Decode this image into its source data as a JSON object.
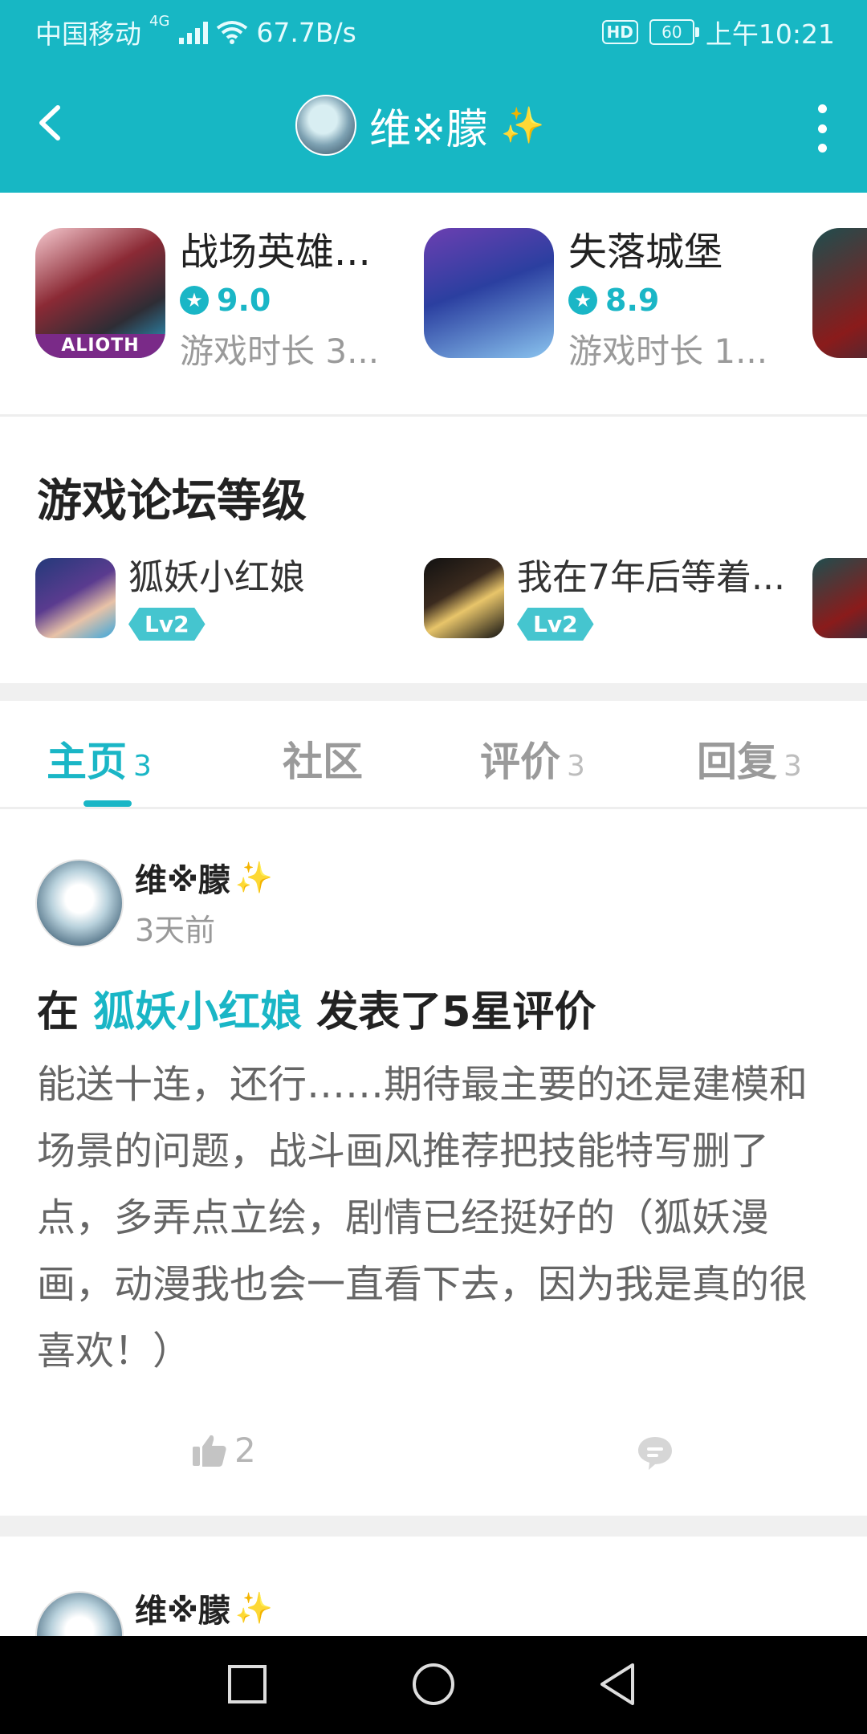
{
  "status_bar": {
    "carrier": "中国移动",
    "network": "4G",
    "speed": "67.7B/s",
    "hd": "HD",
    "battery": "60",
    "time": "上午10:21"
  },
  "app_bar": {
    "title": "维※朦",
    "title_emoji": "✨"
  },
  "games": [
    {
      "name": "战场英雄...",
      "rating": "9.0",
      "playtime": "游戏时长 3...",
      "badge": "ALIOTH"
    },
    {
      "name": "失落城堡",
      "rating": "8.9",
      "playtime": "游戏时长 1..."
    }
  ],
  "forum": {
    "title": "游戏论坛等级",
    "items": [
      {
        "name": "狐妖小红娘",
        "level": "Lv2"
      },
      {
        "name": "我在7年后等着...",
        "level": "Lv2"
      }
    ]
  },
  "tabs": [
    {
      "label": "主页",
      "count": "3"
    },
    {
      "label": "社区",
      "count": ""
    },
    {
      "label": "评价",
      "count": "3"
    },
    {
      "label": "回复",
      "count": "3"
    }
  ],
  "post": {
    "username": "维※朦",
    "emoji": "✨",
    "time": "3天前",
    "headline_prefix": "在",
    "headline_game": "狐妖小红娘",
    "headline_suffix": "发表了5星评价",
    "body": "能送十连，还行……期待最主要的还是建模和场景的问题，战斗画风推荐把技能特写删了点，多弄点立绘，剧情已经挺好的（狐妖漫画，动漫我也会一直看下去，因为我是真的很喜欢！）",
    "likes": "2"
  },
  "post2": {
    "username": "维※朦",
    "emoji": "✨"
  },
  "colors": {
    "accent": "#17b7c4",
    "text_primary": "#222222",
    "text_secondary": "#999999"
  }
}
